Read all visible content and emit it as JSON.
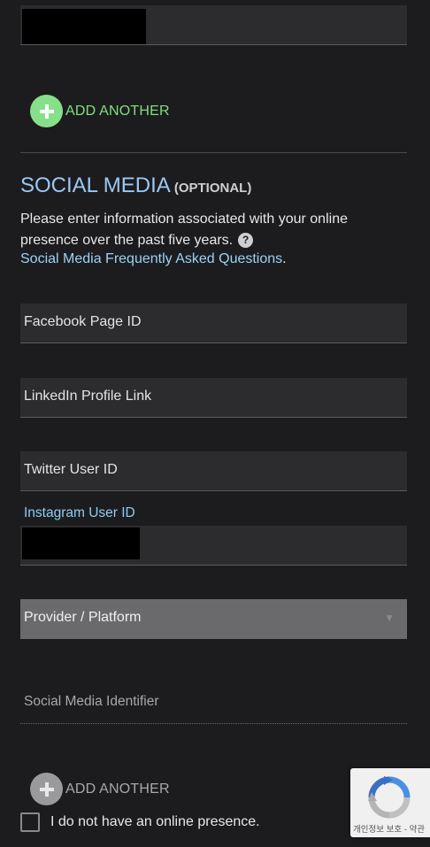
{
  "top": {
    "add_another_label": "ADD ANOTHER"
  },
  "social": {
    "title": "SOCIAL MEDIA",
    "optional_label": "(OPTIONAL)",
    "description": "Please enter information associated with your online presence over the past five years.",
    "help_icon_glyph": "?",
    "faq_link": "Social Media Frequently Asked Questions",
    "faq_link_trailing": ".",
    "fields": {
      "facebook_placeholder": "Facebook Page ID",
      "linkedin_placeholder": "LinkedIn Profile Link",
      "twitter_placeholder": "Twitter User ID",
      "instagram_label": "Instagram User ID"
    },
    "provider_placeholder": "Provider / Platform",
    "identifier_placeholder": "Social Media Identifier",
    "add_another_label": "ADD ANOTHER",
    "no_presence_label": "I do not have an online presence."
  },
  "recaptcha": {
    "text": "개인정보 보호 - 약관"
  },
  "icons": {
    "add_active": "plus-circle-icon",
    "add_disabled": "plus-circle-icon",
    "help": "question-circle-icon",
    "recaptcha": "recaptcha-logo-icon",
    "dropdown": "chevron-down-icon"
  },
  "colors": {
    "background": "#1c1c1e",
    "accent_green": "#7fe07f",
    "add_green_circle": "#86e08a",
    "link_blue": "#9cd2f6",
    "title_blue": "#9cc8f2",
    "disabled_gray": "#a8a8a8"
  }
}
